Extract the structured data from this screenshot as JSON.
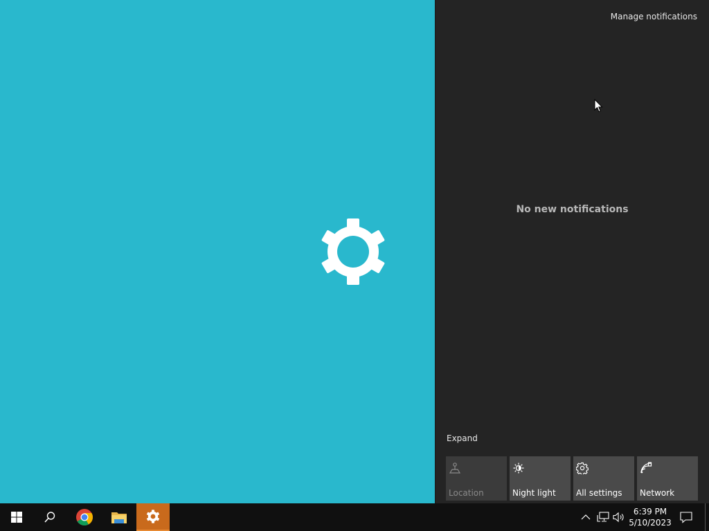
{
  "desktop": {
    "splash_icon": "gear-icon",
    "background_color": "#29b8cd"
  },
  "action_center": {
    "manage_link": "Manage notifications",
    "empty_message": "No new notifications",
    "expand_link": "Expand",
    "tiles": [
      {
        "label": "Location",
        "icon": "location-icon",
        "enabled": false
      },
      {
        "label": "Night light",
        "icon": "night-light-icon",
        "enabled": true
      },
      {
        "label": "All settings",
        "icon": "gear-icon",
        "enabled": true
      },
      {
        "label": "Network",
        "icon": "network-icon",
        "enabled": true
      }
    ]
  },
  "taskbar": {
    "apps": [
      {
        "name": "Start",
        "icon": "windows-icon"
      },
      {
        "name": "Search",
        "icon": "search-icon"
      },
      {
        "name": "Google Chrome",
        "icon": "chrome-icon"
      },
      {
        "name": "File Explorer",
        "icon": "folder-icon"
      },
      {
        "name": "Settings",
        "icon": "gear-icon",
        "active": true
      }
    ],
    "tray": {
      "icons": [
        "chevron-up-icon",
        "network-icon",
        "volume-icon"
      ],
      "time": "6:39 PM",
      "date": "5/10/2023",
      "notification_icon": "notification-icon"
    },
    "accent_color": "#c96a1c"
  }
}
